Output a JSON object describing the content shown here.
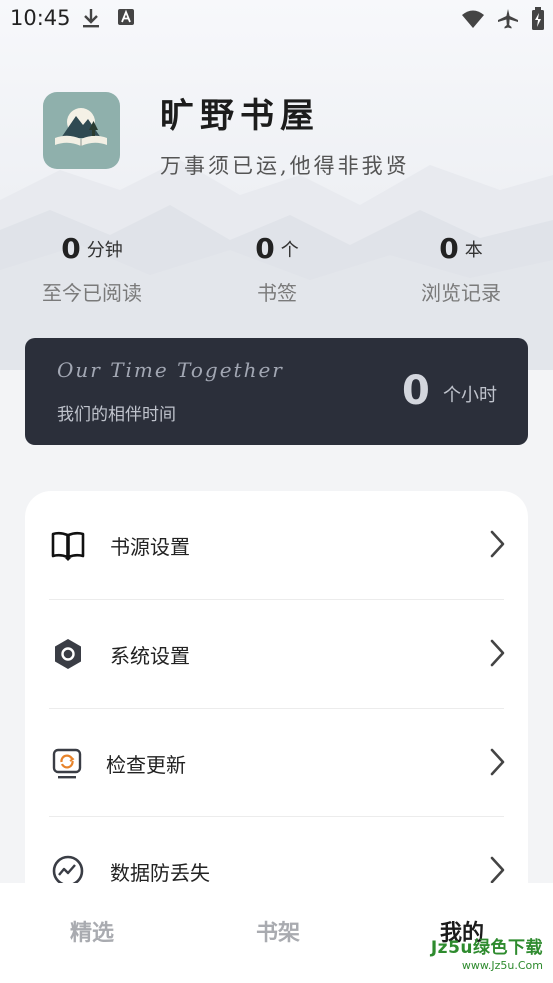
{
  "status_bar": {
    "time": "10:45",
    "icons": [
      "download-icon",
      "a-badge-icon",
      "wifi-icon",
      "airplane-icon",
      "battery-icon"
    ]
  },
  "profile": {
    "app_name": "旷野书屋",
    "slogan": "万事须已运,他得非我贤"
  },
  "stats": [
    {
      "value": "0",
      "unit": "分钟",
      "label": "至今已阅读"
    },
    {
      "value": "0",
      "unit": "个",
      "label": "书签"
    },
    {
      "value": "0",
      "unit": "本",
      "label": "浏览记录"
    }
  ],
  "together": {
    "title_en": "Our Time Together",
    "title_cn": "我们的相伴时间",
    "hours": "0",
    "hours_unit": "个小时"
  },
  "menu": [
    {
      "label": "书源设置",
      "icon": "book-icon"
    },
    {
      "label": "系统设置",
      "icon": "hexagon-settings-icon"
    },
    {
      "label": "检查更新",
      "icon": "update-monitor-icon"
    },
    {
      "label": "数据防丢失",
      "icon": "data-backup-icon"
    }
  ],
  "bottom_nav": {
    "tabs": [
      {
        "label": "精选",
        "active": false
      },
      {
        "label": "书架",
        "active": false
      },
      {
        "label": "我的",
        "active": true
      }
    ]
  },
  "watermark": {
    "line1": "Jz5u绿色下载",
    "line2": "www.Jz5u.Com"
  },
  "colors": {
    "accent_dark": "#2b2f3a",
    "app_icon_bg": "#8fb0ac",
    "watermark": "#2e8b2e"
  }
}
